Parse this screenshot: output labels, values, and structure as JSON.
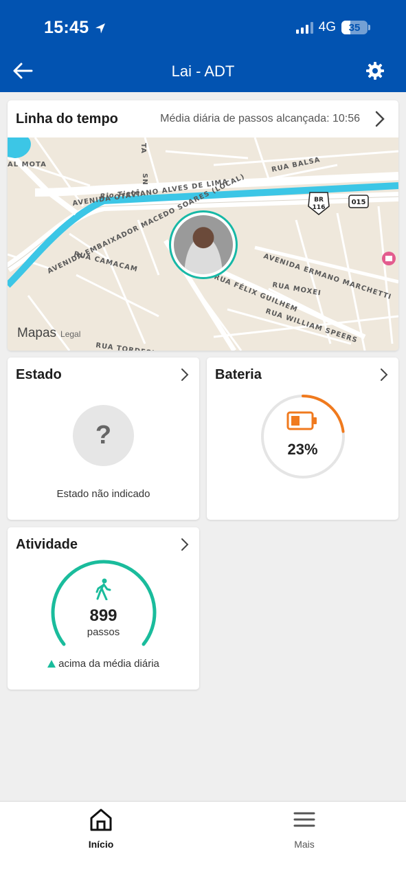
{
  "status_bar": {
    "time": "15:45",
    "network": "4G",
    "battery_level": "35"
  },
  "nav": {
    "title": "Lai - ADT"
  },
  "timeline": {
    "title": "Linha do tempo",
    "subtitle": "Média diária de passos alcançada: 10:56",
    "map": {
      "labels": {
        "avenida_otaviano": "AVENIDA OTAVIANO ALVES DE LIMA",
        "rio_tiete": "Rio Tietê",
        "avenida_embaixador": "AVENIDA EMBAIXADOR MACEDO SOARES (LOCAL)",
        "rua_camacam": "RUA CAMACAM",
        "avenida_ermano": "AVENIDA ERMANO MARCHETTI",
        "rua_felix": "RUA FÉLIX GUILHEM",
        "rua_moxei": "RUA MOXEI",
        "rua_william": "RUA WILLIAM SPEERS",
        "rua_balsa": "RUA BALSA",
        "al_mota": "AL MOTA",
        "rua_tordesilhas": "RUA TORDESILHAS",
        "br": "BR",
        "br_num": "116",
        "route_015": "015",
        "sn": "SN",
        "ta": "TA"
      },
      "brand": "Mapas",
      "legal": "Legal"
    }
  },
  "estado": {
    "title": "Estado",
    "symbol": "?",
    "text": "Estado não indicado"
  },
  "bateria": {
    "title": "Bateria",
    "percent_label": "23%",
    "level": 0.23,
    "color": "#f07a1e"
  },
  "atividade": {
    "title": "Atividade",
    "steps": "899",
    "unit": "passos",
    "note": "acima da média diária",
    "color": "#1abc9c"
  },
  "tabs": [
    {
      "label": "Início",
      "active": true
    },
    {
      "label": "Mais",
      "active": false
    }
  ],
  "colors": {
    "header": "#0253b1",
    "accent": "#17b8a6"
  }
}
